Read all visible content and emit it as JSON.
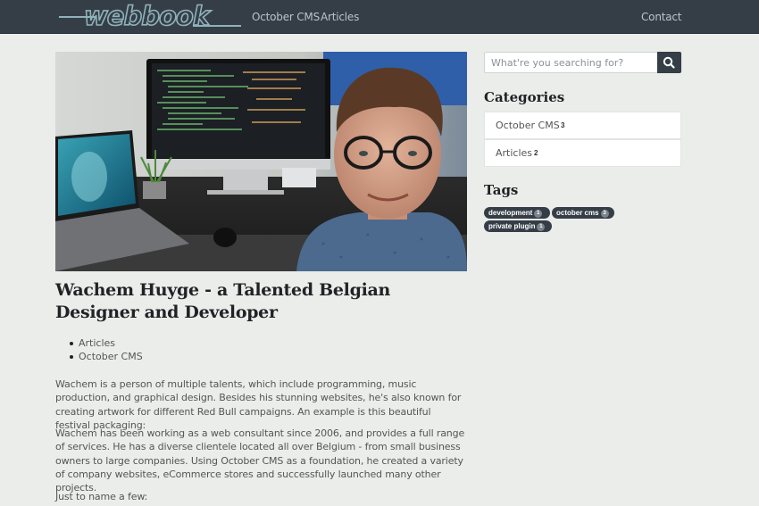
{
  "nav": {
    "logo_text": "webbook",
    "links": [
      "October CMS",
      "Articles"
    ],
    "contact": "Contact"
  },
  "post": {
    "title": "Wachem Huyge - a Talented Belgian Designer and Developer",
    "categories": [
      "Articles",
      "October CMS"
    ],
    "paragraphs": [
      "Wachem is a person of multiple talents, which include programming, music production, and graphical design. Besides his stunning websites, he's also known for creating artwork for different Red Bull campaigns. An example is this beautiful festival packaging:",
      "Wachem has been working as a web consultant since 2006, and provides a full range of services. He has a diverse clientele located all over Belgium - from small business owners to large companies. Using October CMS as a foundation, he created a variety of company websites, eCommerce stores and successfully launched many other projects.",
      "Just to name a few:"
    ]
  },
  "sidebar": {
    "search_placeholder": "What're you searching for?",
    "search_icon": "search-icon",
    "categories_heading": "Categories",
    "categories": [
      {
        "name": "October CMS",
        "count": "3"
      },
      {
        "name": "Articles",
        "count": "2"
      }
    ],
    "tags_heading": "Tags",
    "tags": [
      {
        "name": "development",
        "count": "1"
      },
      {
        "name": "october cms",
        "count": "3"
      },
      {
        "name": "private plugin",
        "count": "1"
      }
    ]
  },
  "colors": {
    "navbar": "#353e47",
    "background": "#ebedea",
    "logo": "#8fb2bb"
  }
}
